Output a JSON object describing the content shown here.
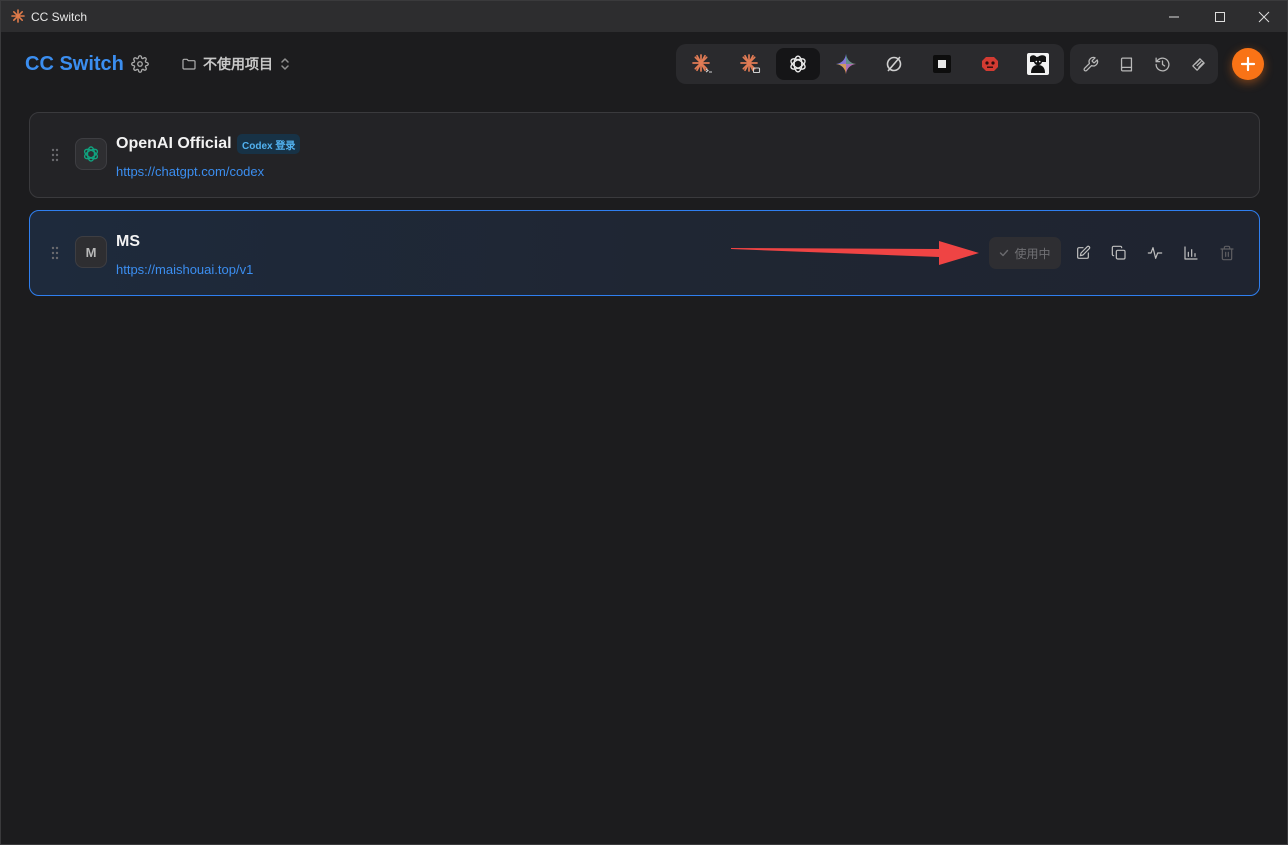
{
  "window": {
    "title": "CC Switch",
    "controls": [
      "minimize-icon",
      "maximize-icon",
      "close-icon"
    ]
  },
  "header": {
    "brand": "CC Switch",
    "project_selector": {
      "label": "不使用项目",
      "icon": "folder-icon",
      "chevron": "chevron-up-down-icon"
    },
    "apps": [
      {
        "name": "claude-code-icon",
        "active": false
      },
      {
        "name": "claude-desktop-icon",
        "active": false
      },
      {
        "name": "openai-codex-icon",
        "active": true
      },
      {
        "name": "gemini-icon",
        "active": false
      },
      {
        "name": "opencode-icon",
        "active": false
      },
      {
        "name": "square-icon",
        "active": false
      },
      {
        "name": "robot-icon",
        "active": false
      },
      {
        "name": "portrait-icon",
        "active": false
      }
    ],
    "tools": [
      "wrench-icon",
      "book-icon",
      "history-icon",
      "layers-icon"
    ],
    "add_icon": "plus-icon"
  },
  "providers": [
    {
      "name": "OpenAI Official",
      "badge": "Codex 登录",
      "url": "https://chatgpt.com/codex",
      "avatar": "openai-logo",
      "selected": false
    },
    {
      "name": "MS",
      "avatar_letter": "M",
      "url": "https://maishouai.top/v1",
      "selected": true,
      "status_button": "使用中",
      "actions": [
        "edit-icon",
        "duplicate-icon",
        "pulse-icon",
        "bar-chart-icon",
        "trash-icon"
      ]
    }
  ],
  "colors": {
    "accent": "#3b8ef0",
    "add_button": "#f97316",
    "selected_border": "#2f7ff0",
    "annotation_arrow": "#ef4444",
    "background": "#1c1c1e"
  }
}
